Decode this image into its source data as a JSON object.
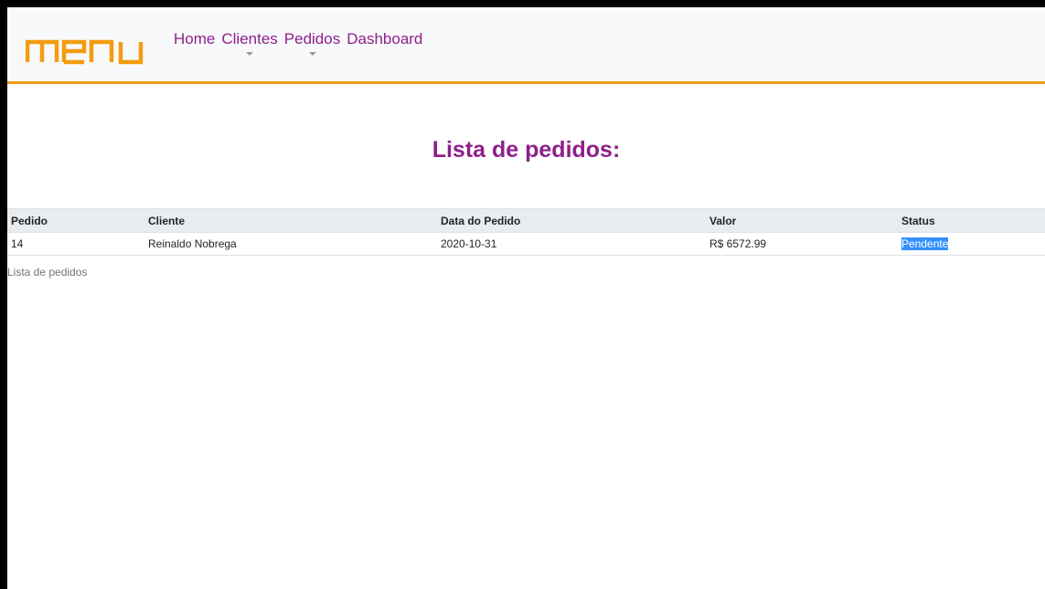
{
  "navbar": {
    "brand": "menu",
    "links": [
      {
        "label": "Home",
        "dropdown": false
      },
      {
        "label": "Clientes",
        "dropdown": true
      },
      {
        "label": "Pedidos",
        "dropdown": true
      },
      {
        "label": "Dashboard",
        "dropdown": false
      }
    ],
    "colors": {
      "link": "#8e1f8a",
      "brand": "#f39c12",
      "border": "#f39c12"
    }
  },
  "main": {
    "title": "Lista de pedidos:",
    "table": {
      "headers": [
        "Pedido",
        "Cliente",
        "Data do Pedido",
        "Valor",
        "Status"
      ],
      "rows": [
        [
          "14",
          "Reinaldo Nobrega",
          "2020-10-31",
          "R$ 6572.99",
          "Pendente"
        ]
      ],
      "caption": "Lista de pedidos"
    }
  }
}
